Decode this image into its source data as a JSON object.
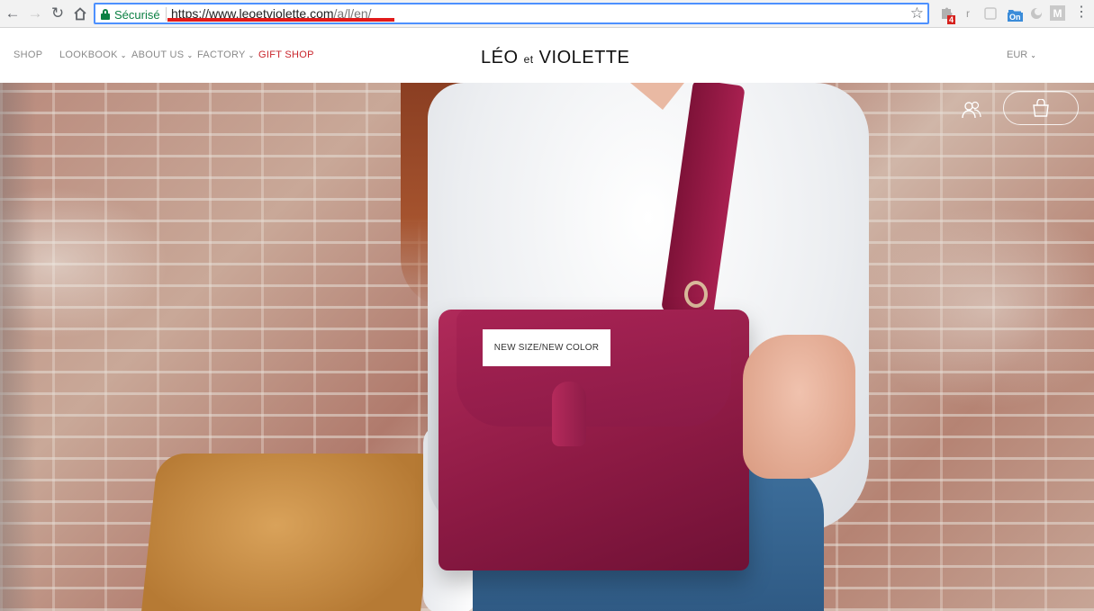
{
  "browser": {
    "secure_label": "Sécurisé",
    "url_main": "https://www.leoetviolette.com",
    "url_path": "/a/l/en/",
    "extension_badge_count": "4",
    "extension_on_label": "On",
    "extension_r_label": "r",
    "extension_m_label": "M"
  },
  "nav": {
    "items": [
      {
        "label": "SHOP"
      },
      {
        "label": "LOOKBOOK"
      },
      {
        "label": "ABOUT US"
      },
      {
        "label": "FACTORY"
      },
      {
        "label": "GIFT SHOP"
      }
    ],
    "chevron": "⌄",
    "gift_color": "#c9252c"
  },
  "logo": {
    "part1": "LÉO",
    "part2": "et",
    "part3": "VIOLETTE"
  },
  "currency": {
    "label": "EUR"
  },
  "hero": {
    "badge_text": "NEW SIZE/NEW COLOR",
    "bag_color": "#8d1a44"
  }
}
